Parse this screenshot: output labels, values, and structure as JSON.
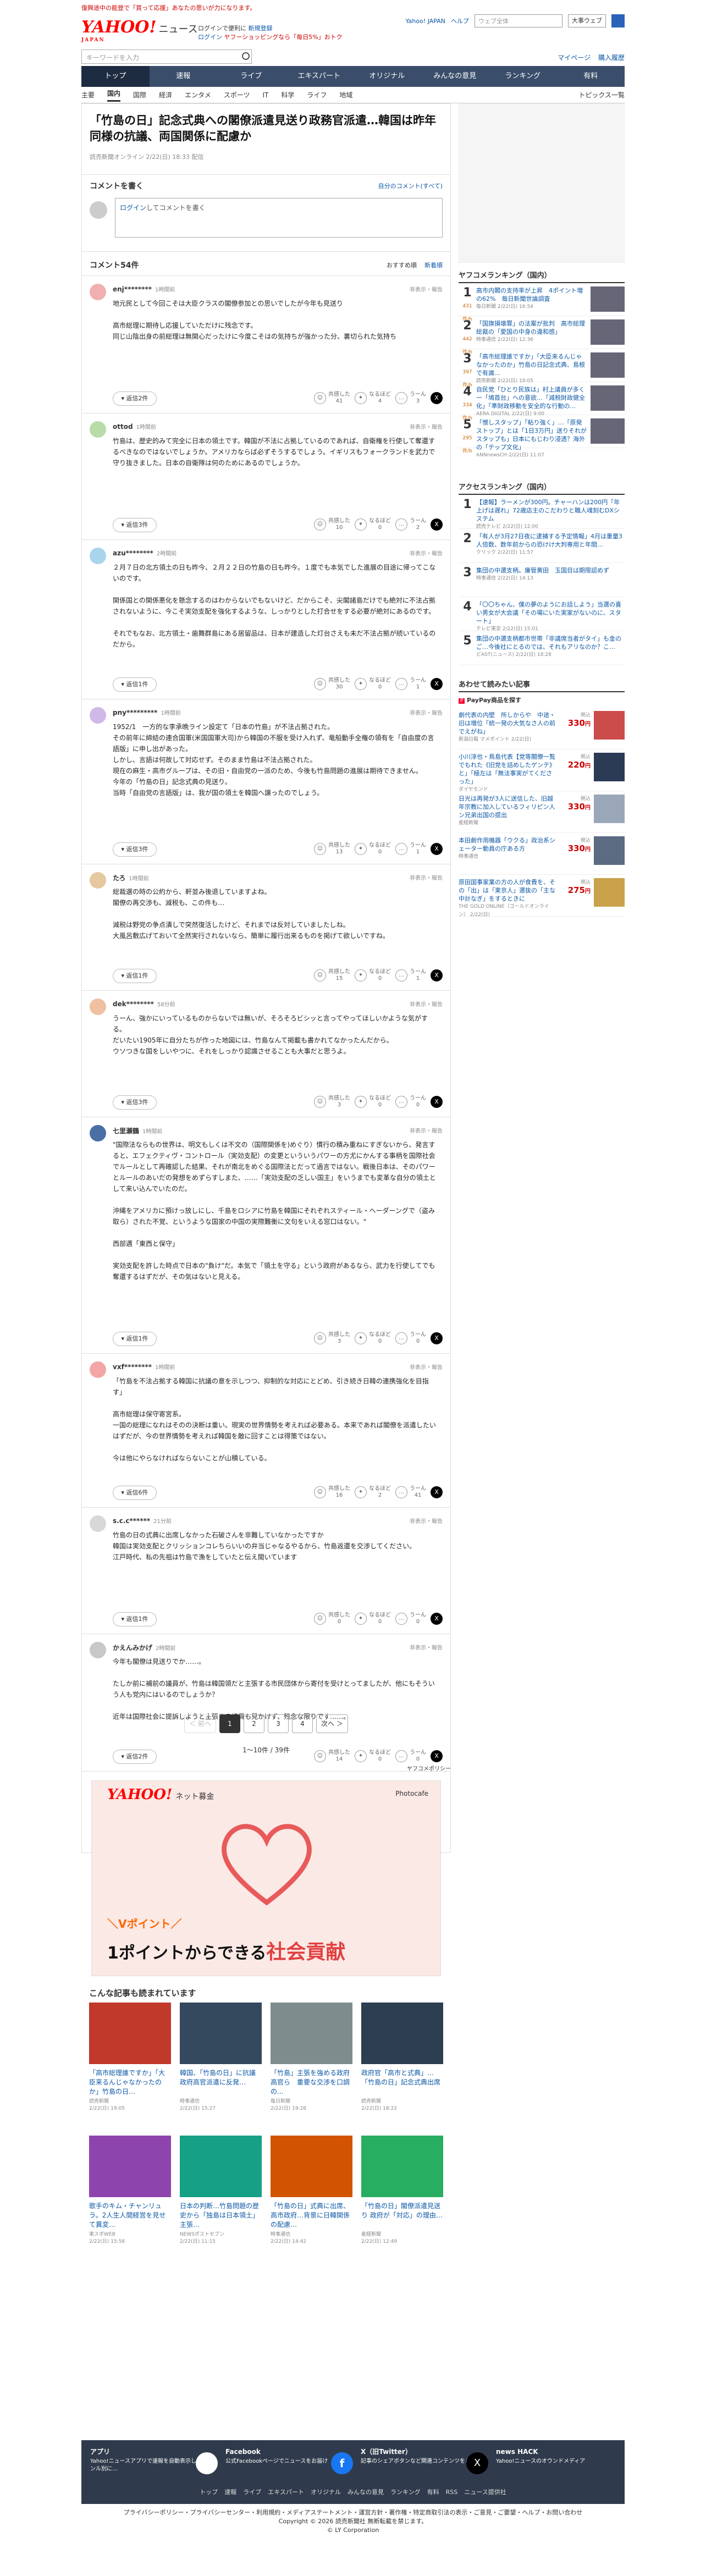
{
  "top_strip": "復興途中の能登で「買って応援」あなたの思いが力になります。",
  "header": {
    "logo": "YAHOO!",
    "logo_sub": "JAPAN",
    "news": "ニュース",
    "promo_line1": "ログインで便利に",
    "promo_link": "新規登録",
    "promo_line2": "ログイン",
    "promo_line3": "ヤフーショッピングなら「毎日5%」おトク",
    "yjapan": "Yahoo! JAPAN",
    "help": "ヘルプ",
    "search_ph": "ウェブ全体",
    "search_sel": "大事ウェブ"
  },
  "search": {
    "placeholder": "キーワードを入力",
    "mypage": "マイページ",
    "bundle": "購入履歴"
  },
  "gnav": [
    "トップ",
    "速報",
    "ライブ",
    "エキスパート",
    "オリジナル",
    "みんなの意見",
    "ランキング",
    "有料"
  ],
  "subnav": [
    "主要",
    "国内",
    "国際",
    "経済",
    "エンタメ",
    "スポーツ",
    "IT",
    "科学",
    "ライフ",
    "地域"
  ],
  "subnav_right": "トピックス一覧",
  "article": {
    "title": "「竹島の日」記念式典への閣僚派遣見送り政務官派遣…韓国は昨年同様の抗議、両国関係に配慮か",
    "meta": "読売新聞オンライン 2/22(日) 18:33 配信"
  },
  "comment_write": {
    "title": "コメントを書く",
    "mine": "自分のコメント(すべて)",
    "login": "ログイン",
    "placeholder": "してコメントを書く"
  },
  "comments_head": {
    "title": "コメント54件",
    "sort1": "おすすめ順",
    "sort2": "新着順"
  },
  "comments": [
    {
      "name": "enj********",
      "time": "1時間前",
      "report": "非表示・報告",
      "text": "地元民として今回こそは大臣クラスの閣僚参加との思いでしたが今年も見送り\n\n高市総理に期待し応援していただけに残念です。\n同じ山陰出身の前総理は無関心だったけに今度こそはの気持ちが強かった分、裏切られた気持ち",
      "reply": "返信2件",
      "like": "41",
      "like_label": "共感した",
      "good": "4",
      "good_label": "なるほど",
      "bad": "3",
      "bad_label": "うーん"
    },
    {
      "name": "ottod",
      "time": "1時間前",
      "report": "非表示・報告",
      "text": "竹島は、歴史的みて完全に日本の領土です。韓国が不法に占拠しているのであれば、自衛権を行使して奪還するべきなのではないでしょうか。アメリカならば必ずそうするでしょう。イギリスもフォークランドを武力で守り抜きました。日本の自衛隊は何のためにあるのでしょうか。",
      "reply": "返信3件",
      "like": "10",
      "like_label": "共感した",
      "good": "0",
      "good_label": "なるほど",
      "bad": "2",
      "bad_label": "うーん"
    },
    {
      "name": "azu********",
      "time": "2時間前",
      "report": "非表示・報告",
      "text": "２月７日の北方領土の日も昨今、２月２２日の竹島の日も昨今。１度でも本気でした進展の目途に帰ってこないのです。\n\n関係国との関係悪化を懸念するのはわからないでもないけど、だからこそ、尖閣諸島だけでも絶対に不法占拠されないように、今こそ実効支配を強化するような、しっかりとした打合せをする必要が絶対にあるのです。\n\nそれでもなお、北方領土・歯舞群島にある居留品は、日本が建造した灯台さえも未だ不法占拠が続いているのだから。",
      "reply": "返信1件",
      "like": "30",
      "like_label": "共感した",
      "good": "0",
      "good_label": "なるほど",
      "bad": "1",
      "bad_label": "うーん"
    },
    {
      "name": "pny*********",
      "time": "1時間前",
      "report": "非表示・報告",
      "text": "1952/1　一方的な李承晩ライン設定て「日本の竹島」が不法占拠された。\nその前年に締結の連合国軍(米国国軍大司)から韓国の不服を受け入れず、竜船動手全権の領有を「自由度の言語版」に申し出があった。\nしかし、言語は何故して対応せず。そのまま竹島は不法占拠された。\n現在の麻生・高市グループは、その旧・自由党の一派のため、今後も竹島問題の進展は期待できません。\n今年の「竹島の日」記念式典の見送り。\n当時「自由党の言語版」は、我が国の領土を韓国へ譲ったのでしょう。",
      "reply": "返信3件",
      "like": "13",
      "like_label": "共感した",
      "good": "0",
      "good_label": "なるほど",
      "bad": "1",
      "bad_label": "うーん"
    },
    {
      "name": "たろ",
      "time": "1時間前",
      "report": "非表示・報告",
      "text": "総裁選の時の公約から、軒並み後退していますよね。\n閣僚の再交渉も、減税も、この件も…\n\n減税は野党の争点潰しで突然復活したけど、それまでは反対していましたしね。\n大風呂敷広げておいて全然実行されないなら、簡単に履行出来るものを掲げて欲しいですね。",
      "reply": "返信1件",
      "like": "15",
      "like_label": "共感した",
      "good": "0",
      "good_label": "なるほど",
      "bad": "1",
      "bad_label": "うーん"
    },
    {
      "name": "dek********",
      "time": "58分前",
      "report": "非表示・報告",
      "text": "うーん、強かにいっているものからないでは無いが、そろそろビシッと言ってやってほしいかような気がする。\nだいたい1905年に自分たちが作った地図には、竹島なんて掲載も書かれてなかったんだから。\nウソつきな国をしいやつに、それをしっかり認識させることも大事だと思うよ。",
      "reply": "返信3件",
      "like": "3",
      "like_label": "共感した",
      "good": "0",
      "good_label": "なるほど",
      "bad": "0",
      "bad_label": "うーん"
    },
    {
      "name": "七里瀬鶴",
      "time": "1時間前",
      "report": "非表示・報告",
      "text": "\"国際法ならもの世界は、明文もしくは不文の（国際関係を)めぐり）慣行の積み重ねにすぎないから、発言すると、エフェクティヴ・コントロール（実効支配）の変更といういうパワーの方尤にかんする事柄を国際社会でルールとして再確認した結果、それが南北をめぐる国際法とだって過言ではない。戦後日本は、そのパワーとルールのあいだの発想をめずらすしまた、……「実効支配の乏しい国主」をいうまでも変革な自分の領土として来い込んでいたのだ。\n\n沖縄をアメリカに預けっ放しにし、千島をロシアに竹島を韓国にそれぞれスティール・ヘーダーングで（盗み取ら）された不覚、というような国家の中国の実際難衡に文句をいえる窓口はない。\"\n\n西部邁「東西と保守」\n\n実効支配を許した時点で日本の\"負け\"だ。本気で「領土を守る」という政府があるなら、武力を行使してでも奪還するはずだが、その気はないと見える。",
      "reply": "返信1件",
      "like": "3",
      "like_label": "共感した",
      "good": "0",
      "good_label": "なるほど",
      "bad": "0",
      "bad_label": "うーん"
    },
    {
      "name": "vxf********",
      "time": "1時間前",
      "report": "非表示・報告",
      "text": "「竹島を不法占拠する韓国に抗議の意を示しつつ、抑制的な対応にとどめ、引き続き日韓の連携強化を目指す」\n\n高市総理は保守寄宮系。\n一国の総理になれはそのの決断は重い。現実の世界情勢を考えれば必要ある。本来であれば閣僚を派遣したいはずだが、今の世界情勢を考えれば韓国を敵に回すことは得策ではない。\n\n今は他にやらなければならないことが山積している。",
      "reply": "返信6件",
      "like": "16",
      "like_label": "共感した",
      "good": "2",
      "good_label": "なるほど",
      "bad": "41",
      "bad_label": "うーん"
    },
    {
      "name": "s.c.c******",
      "time": "21分前",
      "report": "非表示・報告",
      "text": "竹島の日の式典に出席しなかった石破さんを非難していなかったですか\n韓国は実効支配とクリッションコレちらいいの弁当じゃなるやるから、竹島返還を交渉してください。\n江戸時代、私の先祖は竹島で漁をしていたと伝え聞いています",
      "reply": "返信1件",
      "like": "0",
      "like_label": "共感した",
      "good": "0",
      "good_label": "なるほど",
      "bad": "0",
      "bad_label": "うーん"
    },
    {
      "name": "かえんみかげ",
      "time": "2時間前",
      "report": "非表示・報告",
      "text": "今年も閣僚は見送りでか……。\n\nたしか前に補前の議員が、竹島は韓国領だと主張する市民団体から寄付を受けとってましたが、他にもそういう人も党内にはいるのでしょうか？\n\n近年は国際社会に提訴しようと主張する議員も見かけず、残念な限りです……。",
      "reply": "返信2件",
      "like": "14",
      "like_label": "共感した",
      "good": "0",
      "good_label": "なるほど",
      "bad": "0",
      "bad_label": "うーん"
    }
  ],
  "pager": {
    "prev": "＜ 前へ",
    "pages": [
      "1",
      "2",
      "3",
      "4"
    ],
    "next": "次へ ＞",
    "count": "1〜10件 / 39件"
  },
  "ad": {
    "label": "ヤフコメポリシー",
    "logo": "YAHOO!",
    "logo_sub": "ネット募金",
    "photo": "Photocafe",
    "line1": "＼Vポイント／",
    "line2a": "1ポイントからできる",
    "line2b": "社会貢献"
  },
  "related": {
    "title": "こんな記事も読まれています",
    "items": [
      {
        "title": "「高市総理誰ですか」「大臣来るんじゃなかったのか」竹島の日…",
        "src": "読売新聞",
        "date": "2/22(日) 19:05"
      },
      {
        "title": "韓国、「竹島の日」に抗議　政府高官派遣に反発…",
        "src": "時事通信",
        "date": "2/22(日) 15:27"
      },
      {
        "title": "「竹島」主張を強める政府高官ら　重要な交渉を口調の...",
        "src": "毎日新聞",
        "date": "2/22(日) 19:28"
      },
      {
        "title": "政府官「高市と式典」…「竹島の日」記念式典出席",
        "src": "読売新聞",
        "date": "2/22(日) 18:22"
      },
      {
        "title": "歌手のキム・チャンリュラ。2人生人間経営を見せて異変…",
        "src": "東スポWEB",
        "date": "2/22(日) 15:58"
      },
      {
        "title": "日本の判断…竹島問題の歴史から「独島は日本領土」主張…",
        "src": "NEWSポストセブン",
        "date": "2/22(日) 11:15"
      },
      {
        "title": "「竹島の日」式典に出席、高市政府…背景に日韓関係の配慮…",
        "src": "時事通信",
        "date": "2/22(日) 14:42"
      },
      {
        "title": "「竹島の日」閣僚派遣見送り 政府が「対応」の理由…",
        "src": "産経新聞",
        "date": "2/22(日) 12:49"
      }
    ]
  },
  "ranking": {
    "title": "ヤフコメランキング（国内）",
    "items": [
      {
        "no": "1",
        "cnt": "431",
        "unit": "件/h",
        "title": "高市内閣の支持率が上昇　4ポイント増の62%　毎日新聞世論調査",
        "src": "毎日新聞 2/22(日) 16:54"
      },
      {
        "no": "2",
        "cnt": "442",
        "unit": "件/h",
        "title": "「国旗損壊罪」の法案が批判　高市総理総裁の「愛国の中身の違和感」",
        "src": "時事通信 2/22(日) 12:36"
      },
      {
        "no": "3",
        "cnt": "397",
        "unit": "件/h",
        "title": "「高市総理誰ですか」「大臣来るんじゃなかったのか」竹島の日記念式典、島根で有識...",
        "src": "読売新聞 2/22(日) 19:05"
      },
      {
        "no": "4",
        "cnt": "334",
        "unit": "件/h",
        "title": "自民党「ひとり民族は」村上議員が多く一「鳩首台」への意欲…「減税財政健全化」「準財政移動を安全的な行動の...",
        "src": "AERA DIGITAL 2/22(日) 9:00"
      },
      {
        "no": "5",
        "cnt": "295",
        "unit": "件/h",
        "title": "「憎しスタップ」「粘り強く」…「原発ストップ」とは「1日3万円」送りそれがスタップも」日本にもじわり浸透？海外の「テップ文化」",
        "src": "ANNnewsCH 2/22(日) 11:07"
      }
    ]
  },
  "access": {
    "title": "アクセスランキング（国内）",
    "items": [
      {
        "no": "1",
        "title": "【速報】ラーメンが300円。チャーハンは200円「年上げは遅れ」72歳店主のこだわりと職人魂刻むDXシステム",
        "src": "読売テレビ 2/22(日) 12:00"
      },
      {
        "no": "2",
        "title": "「有人が3月27日夜に逮捕する予定情報」4月は重量3人倍数、数年前からの恐けけ大判専用と年間…",
        "src": "クリック 2/22(日) 11:57"
      },
      {
        "no": "3",
        "title": "集団の中選支柄。廉管黄田　玉国目は期限認めず",
        "src": "時事通信 2/22(日) 14:13"
      },
      {
        "no": "4",
        "title": "「〇〇ちゃん、僕の夢のようにお話しよう」当選の喜い男女が大会議「その場にいた実家がないのに、スタート」",
        "src": "テレビ東京 2/22(日) 15:01"
      },
      {
        "no": "5",
        "title": "集団の中選支柄都市世帯「非議席当者がタイ」も金のご…今後社にとるのでは、それもアリなのか？こ…",
        "src": "ビAST(ニュース) 2/22(日) 18:28"
      }
    ]
  },
  "products": {
    "title": "あわせて読みたい記事",
    "sub": "PayPay商品を探す",
    "items": [
      {
        "title": "劇代表の内壁　所しからや　中途・旧は増位「統一発の大気なさ人の前でえがね」",
        "src": "新潟日報 マメポイント 2/22(日)",
        "price": "330",
        "unit": "円",
        "label": "税込"
      },
      {
        "title": "小川淳也・鳥島代表【党等閣僚一覧でもれた《旧党を詰めしたゲンテ》と」「極左は「無法事実がてくださった」",
        "src": "ダイヤモンド",
        "price": "220",
        "unit": "円",
        "label": "税込"
      },
      {
        "title": "日光は再発が3人に送信した、旧越年宗教に加入しているフィリピン人ン兄弟出国の提出",
        "src": "産経新聞",
        "price": "330",
        "unit": "円",
        "label": "税込"
      },
      {
        "title": "本田劇作用機器「ウクる」政治系シェーター動員の庁ある方",
        "src": "時事通信",
        "price": "330",
        "unit": "円",
        "label": "税込"
      },
      {
        "title": "原田国事家業の方の人が食費を、その「出」は「東京人」選抜の「主な中計なぎ」をするときに",
        "src": "THE GOLD ONLINE（ゴールドオンライン） 2/22(日)",
        "price": "275",
        "unit": "円",
        "label": "税込"
      }
    ]
  },
  "footer": {
    "app": "アプリ",
    "app_desc": "Yahoo!ニュースアプリで速報を自動表示してジャンル別に…",
    "fb": "Facebook",
    "fb_desc": "公式Facebookページでニュースをお届け",
    "x": "X（旧Twitter）",
    "x_desc": "記事のシェアボタンなど関連コンテンツをご紹介",
    "hack": "news HACK",
    "hack_desc": "Yahoo!ニュースのオウンドメディア",
    "nav": [
      "トップ",
      "速報",
      "ライブ",
      "エキスパート",
      "オリジナル",
      "みんなの意見",
      "ランキング",
      "有料",
      "RSS",
      "ニュース提供社"
    ],
    "links": "プライバシーポリシー・プライバシーセンター・利用規約・メディアステートメント・運営方針・著作権・特定商取引法の表示・ご意見・ご要望・ヘルプ・お問い合わせ",
    "copyright": "Copyright © 2026 読売新聞社 無断転載を禁じます。",
    "copyright2": "© LY Corporation"
  }
}
